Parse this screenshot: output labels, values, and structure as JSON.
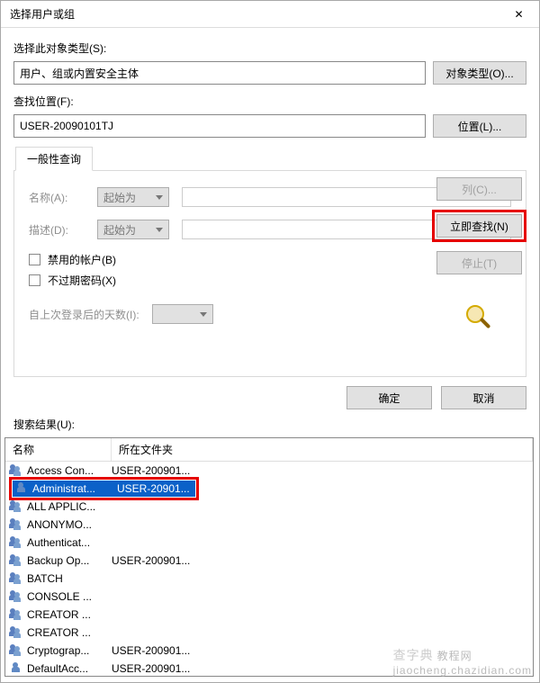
{
  "titlebar": {
    "title": "选择用户或组",
    "close": "✕"
  },
  "object_type": {
    "label": "选择此对象类型(S):",
    "value": "用户、组或内置安全主体",
    "button": "对象类型(O)..."
  },
  "location": {
    "label": "查找位置(F):",
    "value": "USER-20090101TJ",
    "button": "位置(L)..."
  },
  "tab": {
    "header": "一般性查询"
  },
  "filters": {
    "name_label": "名称(A):",
    "name_mode": "起始为",
    "desc_label": "描述(D):",
    "desc_mode": "起始为",
    "disabled_accounts": "禁用的帐户(B)",
    "never_expire": "不过期密码(X)",
    "days_label": "自上次登录后的天数(I):"
  },
  "side": {
    "columns": "列(C)...",
    "find_now": "立即查找(N)",
    "stop": "停止(T)"
  },
  "dialog_buttons": {
    "ok": "确定",
    "cancel": "取消"
  },
  "results": {
    "label": "搜索结果(U):",
    "col_name": "名称",
    "col_folder": "所在文件夹",
    "rows": [
      {
        "name": "Access Con...",
        "folder": "USER-200901...",
        "type": "group",
        "selected": false
      },
      {
        "name": "Administrat...",
        "folder": "USER-20901...",
        "type": "single",
        "selected": true,
        "sel_folder": "USER-20901..."
      },
      {
        "name": "ALL APPLIC...",
        "folder": "",
        "type": "group",
        "selected": false
      },
      {
        "name": "ANONYMO...",
        "folder": "",
        "type": "group",
        "selected": false
      },
      {
        "name": "Authenticat...",
        "folder": "",
        "type": "group",
        "selected": false
      },
      {
        "name": "Backup Op...",
        "folder": "USER-200901...",
        "type": "group",
        "selected": false
      },
      {
        "name": "BATCH",
        "folder": "",
        "type": "group",
        "selected": false
      },
      {
        "name": "CONSOLE ...",
        "folder": "",
        "type": "group",
        "selected": false
      },
      {
        "name": "CREATOR ...",
        "folder": "",
        "type": "group",
        "selected": false
      },
      {
        "name": "CREATOR ...",
        "folder": "",
        "type": "group",
        "selected": false
      },
      {
        "name": "Cryptograp...",
        "folder": "USER-200901...",
        "type": "group",
        "selected": false
      },
      {
        "name": "DefaultAcc...",
        "folder": "USER-200901...",
        "type": "single",
        "selected": false
      }
    ]
  },
  "watermark": {
    "cn": "查字典",
    "en": "jiaocheng.chazidian.com",
    "extra": "教程网"
  }
}
